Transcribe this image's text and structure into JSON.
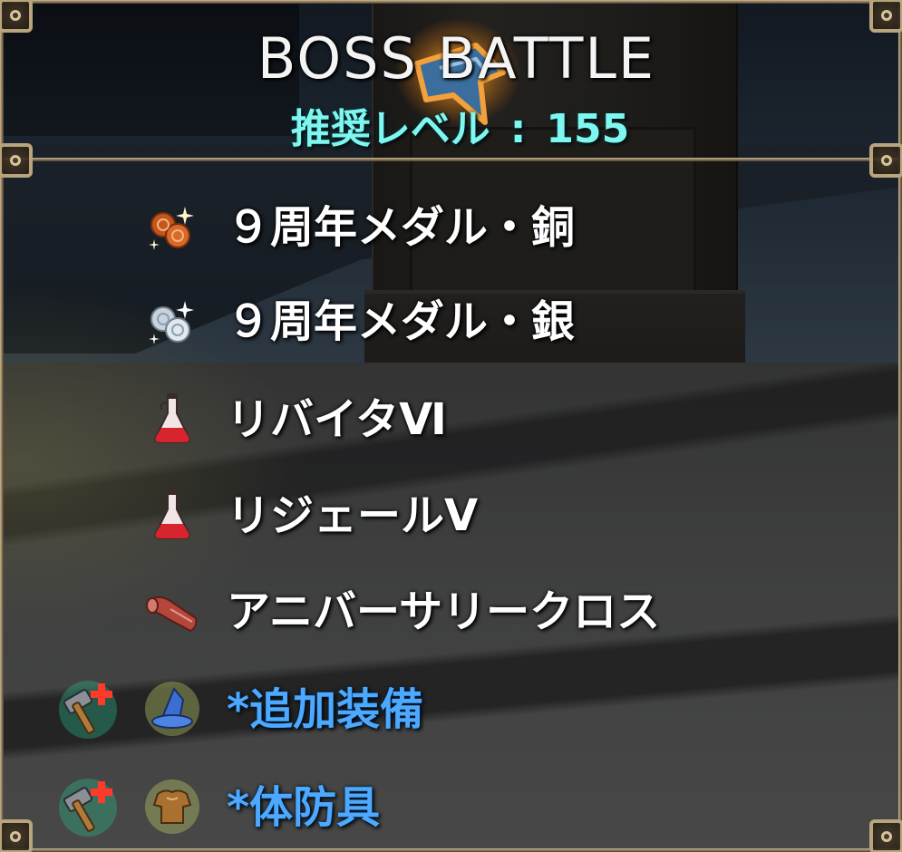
{
  "header": {
    "title": "BOSS BATTLE",
    "level_label": "推奨レベル",
    "level_separator": ":",
    "level_value": "155"
  },
  "rewards": [
    {
      "name": "９周年メダル・銅",
      "icon": "bronze-medal-icon",
      "link": false,
      "upgradable": false
    },
    {
      "name": "９周年メダル・銀",
      "icon": "silver-medal-icon",
      "link": false,
      "upgradable": false
    },
    {
      "name": "リバイタⅥ",
      "icon": "red-potion-icon",
      "link": false,
      "upgradable": false
    },
    {
      "name": "リジェールⅤ",
      "icon": "red-potion-icon",
      "link": false,
      "upgradable": false
    },
    {
      "name": "アニバーサリークロス",
      "icon": "cloth-icon",
      "link": false,
      "upgradable": false
    },
    {
      "name": "*追加装備",
      "icon": "wizard-hat-icon",
      "link": true,
      "upgradable": true,
      "upgrade_icon": "hammer-plus-icon"
    },
    {
      "name": "*体防具",
      "icon": "body-armor-icon",
      "link": true,
      "upgradable": true,
      "upgrade_icon": "hammer-plus-icon"
    }
  ],
  "colors": {
    "title": "#f4f4f4",
    "level": "#7ff6f0",
    "item_text": "#ffffff",
    "link_text": "#4ca9ff",
    "frame": "#b8a47d"
  }
}
